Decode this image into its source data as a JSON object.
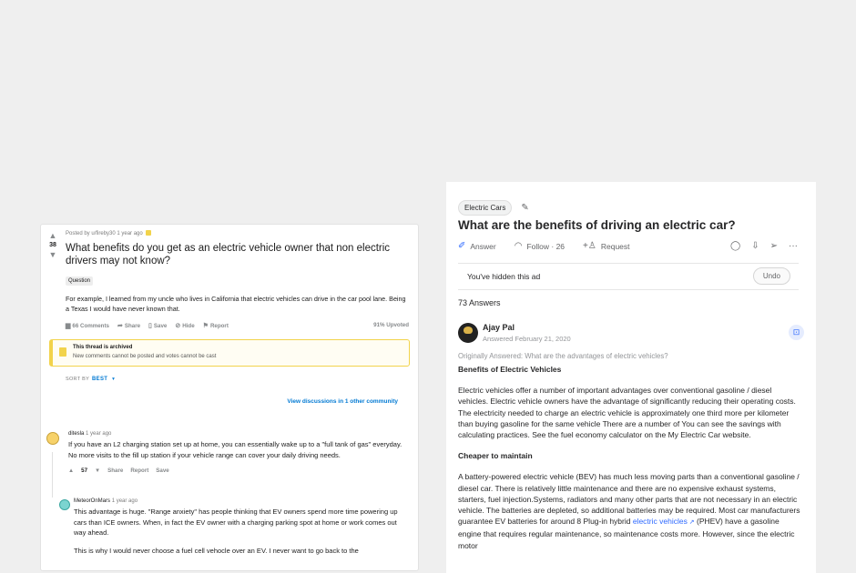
{
  "reddit": {
    "score": "38",
    "meta": "Posted by u/fireby30 1 year ago",
    "title": "What benefits do you get as an electric vehicle owner that non electric drivers may not know?",
    "flair": "Question",
    "text": "For example, I learned from my uncle who lives in California that electric vehicles can drive in the car pool lane. Being a Texas I would have never known that.",
    "actions": {
      "comments": "66 Comments",
      "share": "Share",
      "save": "Save",
      "hide": "Hide",
      "report": "Report"
    },
    "upvoted": "91% Upvoted",
    "archived": {
      "title": "This thread is archived",
      "text": "New comments cannot be posted and votes cannot be cast"
    },
    "sort": {
      "label": "SORT BY",
      "value": "BEST"
    },
    "view_discussions": "View discussions in 1 other community",
    "comments": [
      {
        "user": "ditesla",
        "time": "1 year ago",
        "text": "If you have an L2 charging station set up at home, you can essentially wake up to a \"full tank of gas\" everyday. No more visits to the fill up station if your vehicle range can cover your daily driving needs.",
        "score": "57",
        "share": "Share",
        "report": "Report",
        "save": "Save"
      },
      {
        "user": "MeteorOnMars",
        "time": "1 year ago",
        "text": "This advantage is huge. \"Range anxiety\" has people thinking that EV owners spend more time powering up cars than ICE owners. When, in fact the EV owner with a charging parking spot at home or work comes out way ahead.",
        "text2": "This is why I would never choose a fuel cell vehocle over an EV. I never want to go back to the"
      }
    ]
  },
  "quora": {
    "tag": "Electric Cars",
    "question": "What are the benefits of driving an electric car?",
    "actions": {
      "answer": "Answer",
      "follow": "Follow · 26",
      "request": "Request"
    },
    "hidden_ad": "You've hidden this ad",
    "undo": "Undo",
    "answers_count": "73 Answers",
    "author": {
      "name": "Ajay Pal",
      "date": "Answered February 21, 2020"
    },
    "originally": "Originally Answered: What are the advantages of electric vehicles?",
    "heading1": "Benefits of Electric Vehicles",
    "para1": "Electric vehicles offer a number of important advantages over conventional gasoline / diesel vehicles. Electric vehicle owners have the advantage of significantly reducing their operating costs. The electricity needed to charge an electric vehicle is approximately one third more per kilometer than buying gasoline for the same vehicle There are a number of You can see the savings with calculating practices. See the fuel economy calculator on the My Electric Car website.",
    "heading2": "Cheaper to maintain",
    "para2_a": "A battery-powered electric vehicle (BEV) has much less moving parts than a conventional gasoline / diesel car. There is relatively little maintenance and there are no expensive exhaust systems, starters, fuel injection.Systems, radiators and many other parts that are not necessary in an electric vehicle. The batteries are depleted, so additional batteries may be required. Most car manufacturers guarantee EV batteries for around 8 Plug-in hybrid ",
    "para2_link": "electric vehicles",
    "para2_b": " (PHEV) have a gasoline engine that requires regular maintenance, so maintenance costs more. However, since the electric motor"
  }
}
